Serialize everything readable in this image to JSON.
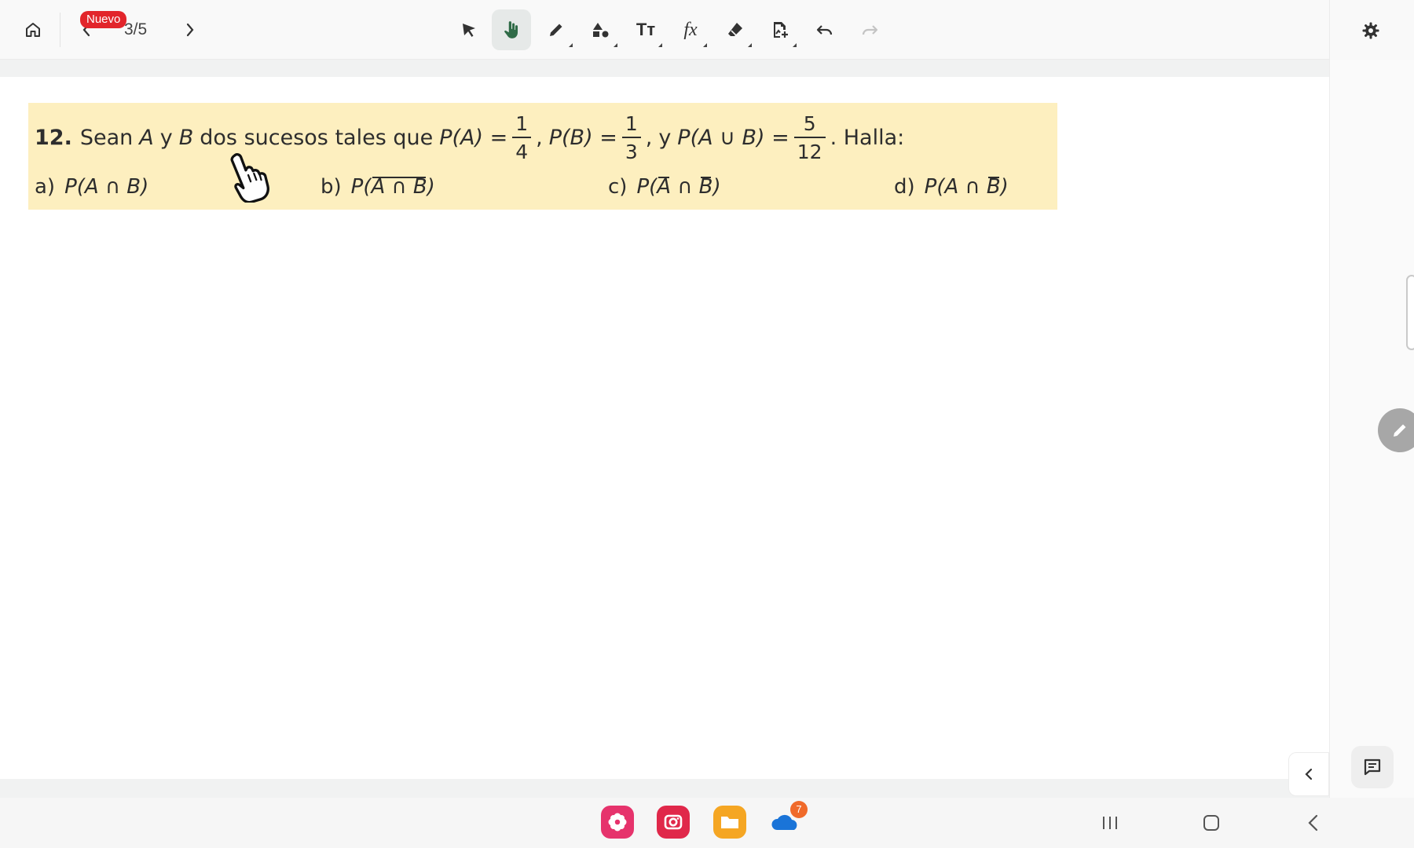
{
  "toolbar": {
    "badge": "Nuevo",
    "page_counter": "3/5",
    "text_tool": "Tт",
    "formula_tool": "fx",
    "active_tool": "hand"
  },
  "problem": {
    "number": "12.",
    "words": {
      "sean": "Sean",
      "y": "y",
      "dos_sucesos": "dos sucesos tales que",
      "halla": ". Halla:"
    },
    "fractions": {
      "pa_num": "1",
      "pa_den": "4",
      "pb_num": "1",
      "pb_den": "3",
      "pu_num": "5",
      "pu_den": "12"
    },
    "parts": [
      {
        "label": "a)"
      },
      {
        "label": "b)"
      },
      {
        "label": "c)"
      },
      {
        "label": "d)"
      }
    ]
  },
  "dock": {
    "onedrive_badge": "7"
  },
  "colors": {
    "problem_bg": "#fdefbf",
    "badge_red": "#e2252b",
    "active_tool_bg": "#e6e9e8",
    "hand_green": "#2f6b47"
  },
  "icons": [
    "home-icon",
    "chevron-left-icon",
    "chevron-right-icon",
    "select-arrow-icon",
    "hand-icon",
    "pen-icon",
    "shapes-icon",
    "text-icon",
    "formula-icon",
    "eraser-icon",
    "add-image-icon",
    "undo-icon",
    "redo-icon",
    "settings-gear-icon",
    "pencil-icon",
    "chevron-left-icon",
    "comment-icon",
    "recents-icon",
    "home-square-icon",
    "back-icon"
  ]
}
